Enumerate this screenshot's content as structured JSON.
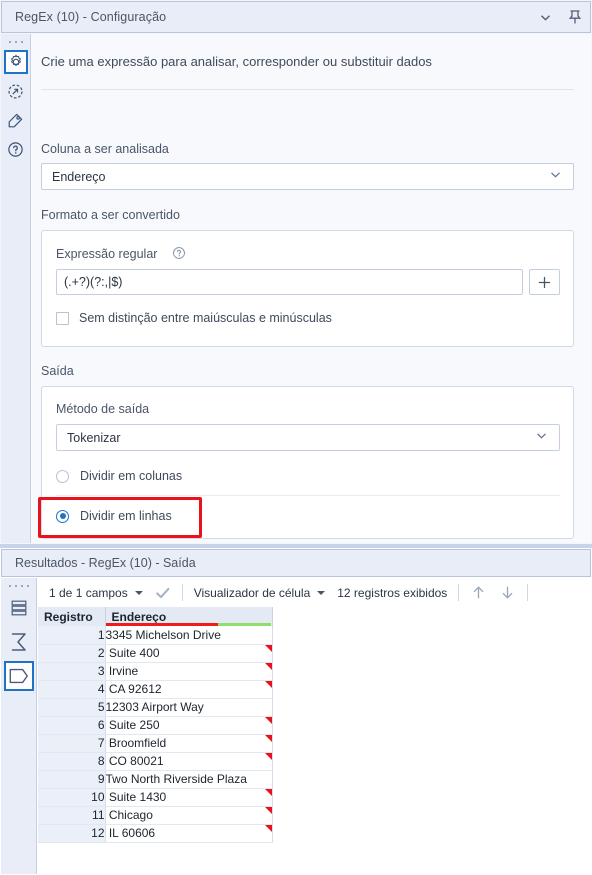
{
  "config_panel": {
    "title": "RegEx (10) - Configuração",
    "titlebar_icons": {
      "collapse": "chevron-down-icon",
      "pin": "pin-icon"
    },
    "rail_icons": [
      "gear-icon",
      "arrow-circle-icon",
      "tag-icon",
      "help-circle-icon"
    ],
    "intro": "Crie uma expressão para analisar, corresponder ou substituir dados",
    "column_section": {
      "label": "Coluna a ser analisada",
      "selected": "Endereço"
    },
    "format_section": {
      "label": "Formato a ser convertido",
      "regex_label": "Expressão regular",
      "regex_value": "(.+?)(?:,|$)",
      "add_button": "+",
      "case_insensitive_label": "Sem distinção entre maiúsculas e minúsculas",
      "case_insensitive_checked": false
    },
    "output_section": {
      "label": "Saída",
      "method_label": "Método de saída",
      "method_selected": "Tokenizar",
      "radio_columns": "Dividir em colunas",
      "radio_rows": "Dividir em linhas",
      "selected_radio": "Dividir em linhas"
    },
    "highlight_color": "#e8131a"
  },
  "results_panel": {
    "title": "Resultados - RegEx (10) - Saída",
    "rail_icons": [
      "rows-icon",
      "sigma-icon",
      "data-shape-icon"
    ],
    "toolbar": {
      "fields": "1 de 1 campos",
      "check_icon": "check-icon",
      "viewer": "Visualizador de célula",
      "records": "12 registros exibidos",
      "up_icon": "arrow-up-icon",
      "down_icon": "arrow-down-icon"
    },
    "table": {
      "headers": [
        "Registro",
        "Endereço"
      ],
      "header_bar": {
        "red": "#ee1c1c",
        "green": "#8fe06a"
      },
      "rows": [
        {
          "record": "1",
          "address": "3345 Michelson Drive",
          "flag": false
        },
        {
          "record": "2",
          "address": " Suite 400",
          "flag": true
        },
        {
          "record": "3",
          "address": " Irvine",
          "flag": true
        },
        {
          "record": "4",
          "address": " CA 92612",
          "flag": true
        },
        {
          "record": "5",
          "address": "12303 Airport Way",
          "flag": false
        },
        {
          "record": "6",
          "address": " Suite 250",
          "flag": true
        },
        {
          "record": "7",
          "address": " Broomfield",
          "flag": true
        },
        {
          "record": "8",
          "address": " CO 80021",
          "flag": true
        },
        {
          "record": "9",
          "address": "Two North Riverside Plaza",
          "flag": false
        },
        {
          "record": "10",
          "address": " Suite 1430",
          "flag": true
        },
        {
          "record": "11",
          "address": " Chicago",
          "flag": true
        },
        {
          "record": "12",
          "address": " IL 60606",
          "flag": true
        }
      ]
    }
  }
}
